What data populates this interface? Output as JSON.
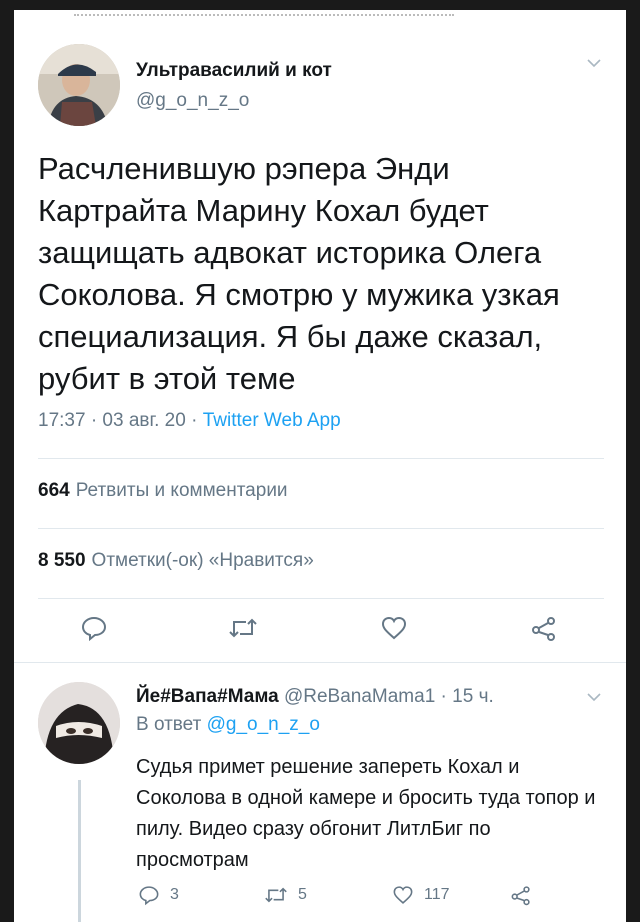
{
  "tweet": {
    "author_name": "Ультравасилий и кот",
    "author_handle": "@g_o_n_z_o",
    "text": "Расчленившую рэпера Энди Картрайта Марину Кохал будет защищать адвокат историка Олега Соколова. Я смотрю у мужика узкая специализация. Я бы даже сказал, рубит в этой теме",
    "time": "17:37 · 03 авг. 20 ·",
    "source": "Twitter Web App",
    "retweets_count": "664",
    "retweets_label": "Ретвиты и комментарии",
    "likes_count": "8 550",
    "likes_label": "Отметки(-ок) «Нравится»",
    "actions": [
      "reply-icon",
      "retweet-icon",
      "like-icon",
      "share-icon"
    ]
  },
  "reply": {
    "author_name": "Йе#Вапа#Мама",
    "author_handle": "@ReBanaMama1 · 15 ч.",
    "reply_to_label": "В ответ",
    "reply_to_user": "@g_o_n_z_o",
    "text": "Судья примет решение запереть Кохал и Соколова в одной камере и бросить туда топор и пилу. Видео сразу обгонит ЛитлБиг по просмотрам",
    "reply_count": "3",
    "retweet_count": "5",
    "like_count": "117"
  },
  "colors": {
    "link": "#1da1f2",
    "muted": "#657786",
    "text": "#14171a",
    "background": "#1a1a1a"
  }
}
